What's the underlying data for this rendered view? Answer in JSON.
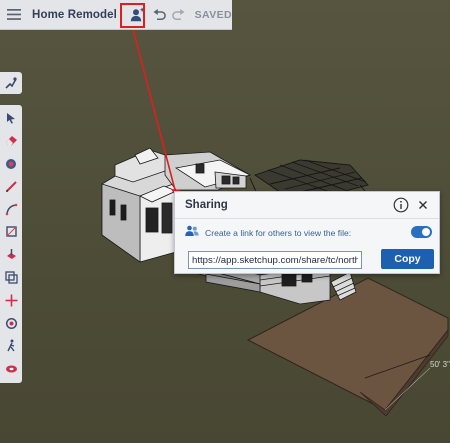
{
  "toolbar": {
    "menu_icon": "hamburger-menu-icon",
    "title": "Home Remodel",
    "share_icon": "share-person-icon",
    "undo_icon": "undo-icon",
    "redo_icon": "redo-icon",
    "status": "SAVED"
  },
  "tools": [
    "walk-icon",
    "select-arrow-icon",
    "eraser-icon",
    "paint-bucket-icon",
    "pencil-icon",
    "arc-icon",
    "rectangle-icon",
    "push-pull-icon",
    "offset-icon",
    "move-icon",
    "rotate-icon",
    "walk-person-icon",
    "tape-measure-icon"
  ],
  "sharing": {
    "title": "Sharing",
    "info_icon": "info-icon",
    "close_icon": "close-icon",
    "share_icon": "people-icon",
    "message": "Create a link for others to view the file:",
    "link_enabled": true,
    "url": "https://app.sketchup.com/share/tc/north",
    "copy_label": "Copy"
  },
  "dimension_label": "50' 3\"",
  "colors": {
    "accent": "#1e5fb0",
    "highlight": "#e01e1e",
    "background": "#4f4e38"
  }
}
